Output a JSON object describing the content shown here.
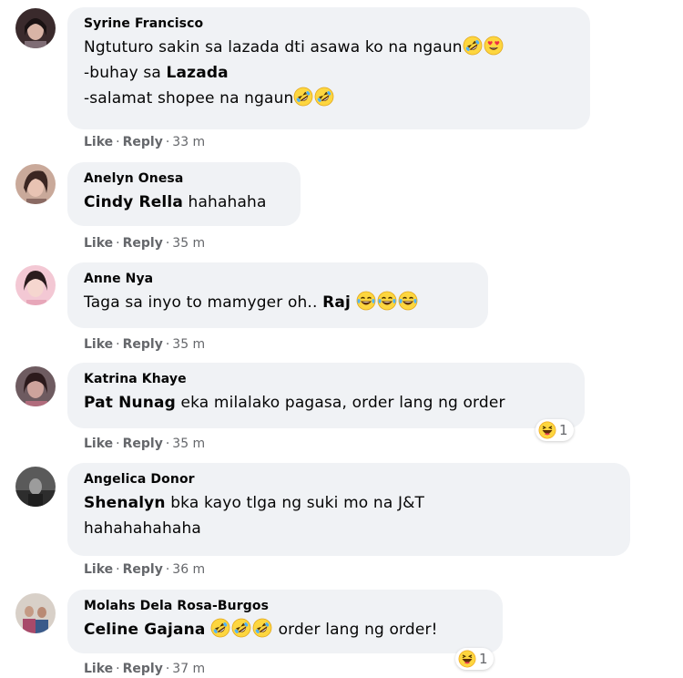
{
  "comments": [
    {
      "author": "Syrine Francisco",
      "line1": "Ngtuturo sakin sa lazada dti asawa ko na ngaun",
      "line2": "-buhay sa ",
      "line2_bold": "Lazada",
      "line3": "-salamat shopee na ngaun",
      "actions": {
        "like": "Like",
        "reply": "Reply",
        "time": "33 m"
      }
    },
    {
      "author": "Anelyn Onesa",
      "mention": "Cindy Rella",
      "text": " hahahaha",
      "actions": {
        "like": "Like",
        "reply": "Reply",
        "time": "35 m"
      }
    },
    {
      "author": "Anne Nya",
      "text": "Taga sa inyo to mamyger oh.. ",
      "mention": "Raj",
      "actions": {
        "like": "Like",
        "reply": "Reply",
        "time": "35 m"
      }
    },
    {
      "author": "Katrina Khaye",
      "mention": "Pat Nunag",
      "text": " eka milalako pagasa, order lang ng order",
      "reaction_count": "1",
      "actions": {
        "like": "Like",
        "reply": "Reply",
        "time": "35 m"
      }
    },
    {
      "author": "Angelica Donor",
      "mention": "Shenalyn",
      "text": " bka kayo tlga ng suki mo na J&T",
      "text2": "hahahahahaha",
      "actions": {
        "like": "Like",
        "reply": "Reply",
        "time": "36 m"
      }
    },
    {
      "author": "Molahs Dela Rosa-Burgos",
      "mention": "Celine Gajana",
      "text": " order lang ng order!",
      "reaction_count": "1",
      "actions": {
        "like": "Like",
        "reply": "Reply",
        "time": "37 m"
      }
    }
  ],
  "separator": "·",
  "colors": {
    "bubble": "#f0f2f5",
    "meta": "#65676b",
    "text": "#050505",
    "emoji_face": "#fdd63f",
    "heart": "#ef2c45"
  },
  "icons": {
    "laughing": "rolling-on-floor-laughing-emoji",
    "heart_eyes": "heart-eyes-emoji",
    "tears_of_joy": "tears-of-joy-emoji",
    "haha_reaction": "haha-reaction-icon"
  }
}
